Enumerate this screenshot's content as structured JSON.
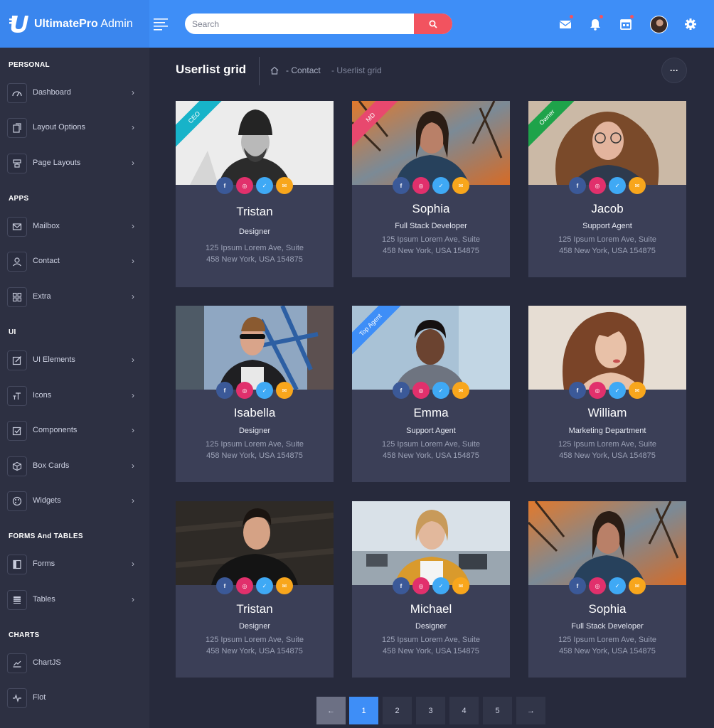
{
  "brand": {
    "bold": "UltimatePro",
    "light": "Admin"
  },
  "search": {
    "placeholder": "Search"
  },
  "topbar_icons": [
    "menu-icon",
    "mail-icon",
    "bell-icon",
    "calendar-icon",
    "settings-icon"
  ],
  "colors": {
    "topbar": "#3e8ef7",
    "sidebar": "#2d3042",
    "background": "#272a3c",
    "card": "#3b3f57",
    "accent_red": "#f2535f",
    "active_page": "#3e8ef7"
  },
  "sidebar": {
    "sections": [
      "PERSONAL",
      "APPS",
      "UI",
      "FORMS And TABLES",
      "CHARTS"
    ],
    "items": [
      {
        "label": "Dashboard",
        "icon": "dashboard-icon"
      },
      {
        "label": "Layout Options",
        "icon": "layout-icon"
      },
      {
        "label": "Page Layouts",
        "icon": "pages-icon"
      },
      {
        "label": "Mailbox",
        "icon": "mail-icon"
      },
      {
        "label": "Contact",
        "icon": "user-icon"
      },
      {
        "label": "Extra",
        "icon": "grid-icon"
      },
      {
        "label": "UI Elements",
        "icon": "edit-icon"
      },
      {
        "label": "Icons",
        "icon": "text-icon"
      },
      {
        "label": "Components",
        "icon": "check-square-icon"
      },
      {
        "label": "Box Cards",
        "icon": "box-icon"
      },
      {
        "label": "Widgets",
        "icon": "palette-icon"
      },
      {
        "label": "Forms",
        "icon": "forms-icon"
      },
      {
        "label": "Tables",
        "icon": "table-icon"
      },
      {
        "label": "ChartJS",
        "icon": "line-chart-icon"
      },
      {
        "label": "Flot",
        "icon": "pulse-icon"
      }
    ]
  },
  "page": {
    "title": "Userlist grid",
    "breadcrumb": [
      "Contact",
      "Userlist grid"
    ],
    "more_label": "···"
  },
  "cards": [
    {
      "name": "Tristan",
      "role": "Designer",
      "addr1": "125 Ipsum Lorem Ave, Suite",
      "addr2": "458 New York, USA 154875",
      "ribbon": "CEO",
      "ribbon_color": "#17b3c9"
    },
    {
      "name": "Sophia",
      "role": "Full Stack Developer",
      "addr1": "125 Ipsum Lorem Ave, Suite",
      "addr2": "458 New York, USA 154875",
      "ribbon": "MD",
      "ribbon_color": "#e8486e"
    },
    {
      "name": "Jacob",
      "role": "Support Agent",
      "addr1": "125 Ipsum Lorem Ave, Suite",
      "addr2": "458 New York, USA 154875",
      "ribbon": "Owner",
      "ribbon_color": "#1ea34a"
    },
    {
      "name": "Isabella",
      "role": "Designer",
      "addr1": "125 Ipsum Lorem Ave, Suite",
      "addr2": "458 New York, USA 154875"
    },
    {
      "name": "Emma",
      "role": "Support Agent",
      "addr1": "125 Ipsum Lorem Ave, Suite",
      "addr2": "458 New York, USA 154875",
      "ribbon": "Top Agent",
      "ribbon_color": "#3e8ef7"
    },
    {
      "name": "William",
      "role": "Marketing Department",
      "addr1": "125 Ipsum Lorem Ave, Suite",
      "addr2": "458 New York, USA 154875"
    },
    {
      "name": "Tristan",
      "role": "Designer",
      "addr1": "125 Ipsum Lorem Ave, Suite",
      "addr2": "458 New York, USA 154875"
    },
    {
      "name": "Michael",
      "role": "Designer",
      "addr1": "125 Ipsum Lorem Ave, Suite",
      "addr2": "458 New York, USA 154875"
    },
    {
      "name": "Sophia",
      "role": "Full Stack Developer",
      "addr1": "125 Ipsum Lorem Ave, Suite",
      "addr2": "458 New York, USA 154875"
    }
  ],
  "social_icons": [
    "facebook-icon",
    "instagram-icon",
    "twitter-icon",
    "mail-icon"
  ],
  "pagination": {
    "prev": "←",
    "pages": [
      "1",
      "2",
      "3",
      "4",
      "5"
    ],
    "next": "→",
    "active": "1"
  }
}
